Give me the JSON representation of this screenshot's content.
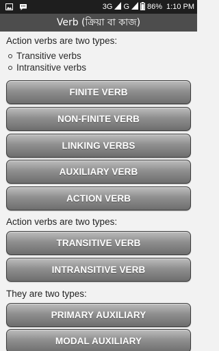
{
  "status_bar": {
    "network_3g": "3G",
    "network_g": "G",
    "battery": "86%",
    "time": "1:10 PM",
    "left_icons": [
      "image-icon",
      "chat-icon"
    ],
    "right_icons": [
      "signal-icon",
      "signal-icon",
      "battery-icon"
    ]
  },
  "title": "Verb (ক্রিয়া বা কাজ)",
  "sections": {
    "heading_1": "Action verbs are two types:",
    "bullets": [
      "Transitive verbs",
      "Intransitive verbs"
    ],
    "heading_2": "Action verbs are two types:",
    "heading_3": "They are two types:"
  },
  "buttons": {
    "finite": "FINITE VERB",
    "non_finite": "NON-FINITE VERB",
    "linking": "LINKING VERBS",
    "auxiliary": "AUXILIARY VERB",
    "action": "ACTION VERB",
    "transitive": "TRANSITIVE VERB",
    "intransitive": "INTRANSITIVE VERB",
    "primary_auxiliary": "PRIMARY AUXILIARY",
    "modal_auxiliary": "MODAL AUXILIARY"
  },
  "colors": {
    "status_bar": "#1e1e1e",
    "title_bar": "#4d4d4d",
    "background": "#f2f2f2",
    "button_text": "#ffffff"
  }
}
